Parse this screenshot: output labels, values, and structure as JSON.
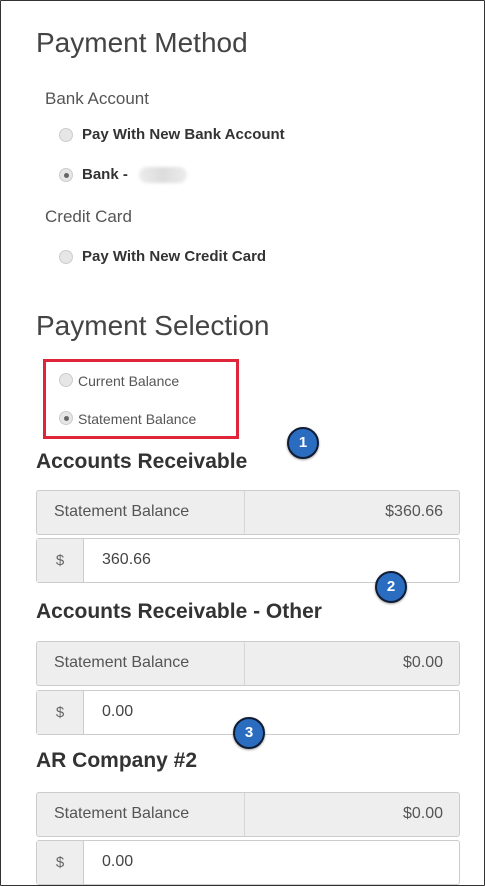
{
  "payment_method": {
    "title": "Payment Method",
    "bank_heading": "Bank Account",
    "bank_options": [
      {
        "label": "Pay With New Bank Account",
        "selected": false
      },
      {
        "label": "Bank -",
        "selected": true
      }
    ],
    "credit_heading": "Credit Card",
    "credit_options": [
      {
        "label": "Pay With New Credit Card",
        "selected": false
      }
    ]
  },
  "payment_selection": {
    "title": "Payment Selection",
    "options": [
      {
        "label": "Current Balance",
        "selected": false
      },
      {
        "label": "Statement Balance",
        "selected": true
      }
    ],
    "highlight_color": "#e0253a"
  },
  "accounts": [
    {
      "badge": "1",
      "name": "Accounts Receivable",
      "balance_label": "Statement Balance",
      "balance": "$360.66",
      "currency": "$",
      "input_value": "360.66"
    },
    {
      "badge": "2",
      "name": "Accounts Receivable - Other",
      "balance_label": "Statement Balance",
      "balance": "$0.00",
      "currency": "$",
      "input_value": "0.00"
    },
    {
      "badge": "3",
      "name": "AR Company #2",
      "balance_label": "Statement Balance",
      "balance": "$0.00",
      "currency": "$",
      "input_value": "0.00"
    }
  ],
  "colors": {
    "badge": "#2a6cbf",
    "badge_border": "#101c33",
    "text": "#333333",
    "panel": "#eeeeee"
  }
}
